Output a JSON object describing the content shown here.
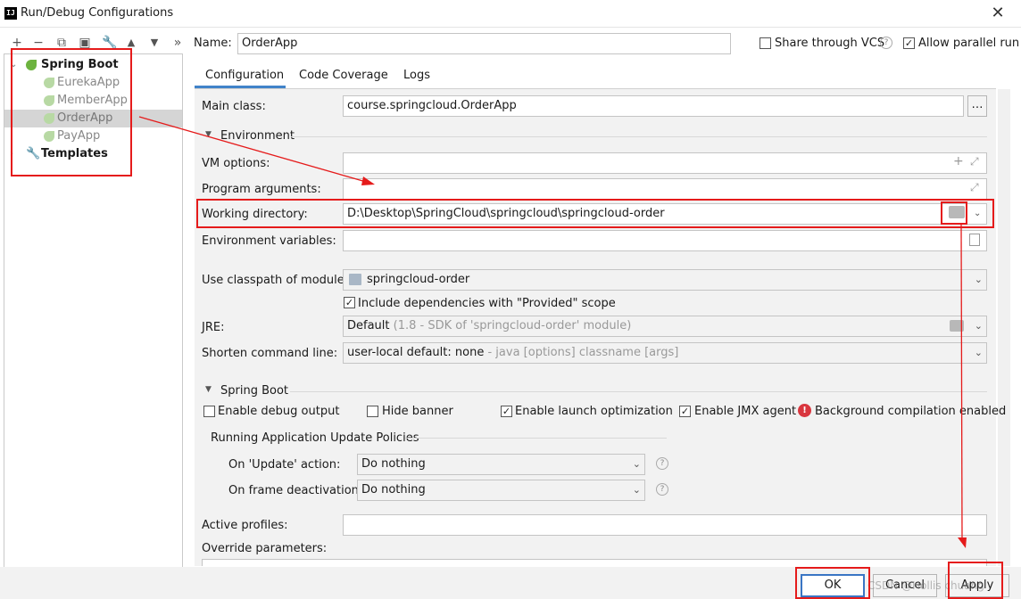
{
  "window": {
    "title": "Run/Debug Configurations",
    "app_icon": "IJ"
  },
  "toolbar": [
    "+",
    "−",
    "⧉",
    "▣",
    "🔧",
    "▲",
    "▼",
    "»"
  ],
  "tree": {
    "spring_boot": "Spring Boot",
    "items": [
      "EurekaApp",
      "MemberApp",
      "OrderApp",
      "PayApp"
    ],
    "templates": "Templates"
  },
  "header": {
    "name_label": "Name:",
    "name_value": "OrderApp",
    "share_label": "Share through VCS",
    "allow_parallel_label": "Allow parallel run"
  },
  "tabs": [
    "Configuration",
    "Code Coverage",
    "Logs"
  ],
  "config": {
    "main_class_label": "Main class:",
    "main_class_value": "course.springcloud.OrderApp",
    "environment_section": "Environment",
    "vm_options_label": "VM options:",
    "program_args_label": "Program arguments:",
    "working_dir_label": "Working directory:",
    "working_dir_value": "D:\\Desktop\\SpringCloud\\springcloud\\springcloud-order",
    "env_vars_label": "Environment variables:",
    "classpath_label": "Use classpath of module:",
    "classpath_value": "springcloud-order",
    "include_deps_label": "Include dependencies with \"Provided\" scope",
    "jre_label": "JRE:",
    "jre_value": "Default",
    "jre_hint": "(1.8 - SDK of 'springcloud-order' module)",
    "shorten_label": "Shorten command line:",
    "shorten_value": "user-local default: none",
    "shorten_hint": "- java [options] classname [args]"
  },
  "spring_boot": {
    "section": "Spring Boot",
    "enable_debug": "Enable debug output",
    "hide_banner": "Hide banner",
    "launch_opt": "Enable launch optimization",
    "jmx": "Enable JMX agent",
    "bg_compile": "Background compilation enabled",
    "policies_title": "Running Application Update Policies",
    "update_label": "On 'Update' action:",
    "update_value": "Do nothing",
    "frame_label": "On frame deactivation:",
    "frame_value": "Do nothing"
  },
  "bottom": {
    "active_profiles_label": "Active profiles:",
    "override_label": "Override parameters:"
  },
  "buttons": {
    "ok": "OK",
    "cancel": "Cancel",
    "apply": "Apply"
  },
  "watermark": "CSDN @Hollis chuang"
}
